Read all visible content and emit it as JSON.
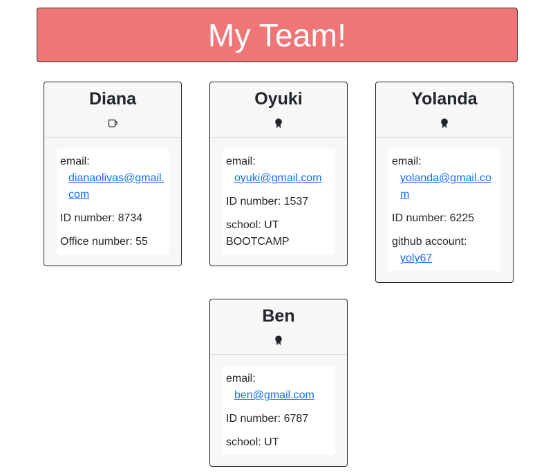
{
  "header": {
    "title": "My Team!"
  },
  "employees": [
    {
      "name": "Diana",
      "icon": "mug-icon",
      "email_label": "email:",
      "email": "dianaolivas@gmail.com",
      "id_text": "ID number: 8734",
      "extra_text": "Office number: 55"
    },
    {
      "name": "Oyuki",
      "icon": "award-icon",
      "email_label": "email:",
      "email": "oyuki@gmail.com",
      "id_text": "ID number: 1537",
      "extra_text": "school: UT BOOTCAMP"
    },
    {
      "name": "Yolanda",
      "icon": "award-icon",
      "email_label": "email:",
      "email": "yolanda@gmail.com",
      "id_text": "ID number: 6225",
      "extra_label": "github account:",
      "extra_link": "yoly67"
    },
    {
      "name": "Ben",
      "icon": "award-icon",
      "email_label": "email:",
      "email": "ben@gmail.com",
      "id_text": "ID number: 6787",
      "extra_text": "school: UT"
    }
  ],
  "colors": {
    "header_bg": "#ee7677",
    "link": "#0d6efd"
  }
}
